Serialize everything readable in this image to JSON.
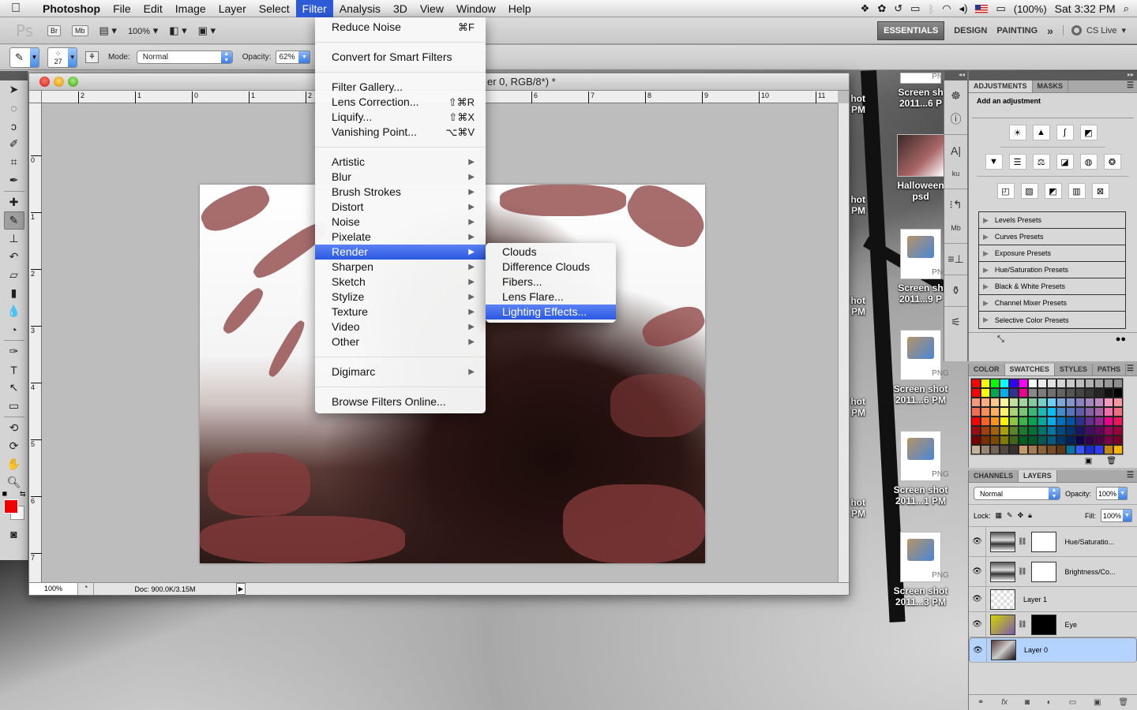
{
  "menubar": {
    "app_name": "Photoshop",
    "items": [
      "File",
      "Edit",
      "Image",
      "Layer",
      "Select",
      "Filter",
      "Analysis",
      "3D",
      "View",
      "Window",
      "Help"
    ],
    "active_item": "Filter",
    "battery": "(100%)",
    "clock": "Sat 3:32 PM"
  },
  "appbar": {
    "logo": "Ps",
    "bridge": "Br",
    "minibridge": "Mb",
    "zoom": "100%",
    "workspaces": [
      "ESSENTIALS",
      "DESIGN",
      "PAINTING"
    ],
    "active_workspace": "ESSENTIALS",
    "more": "»",
    "cs_live": "CS Live"
  },
  "options": {
    "brush_size": "27",
    "mode_label": "Mode:",
    "mode_value": "Normal",
    "opacity_label": "Opacity:",
    "opacity_value": "62%"
  },
  "document": {
    "title": "er 0, RGB/8*) *",
    "ruler_h": [
      "2",
      "1",
      "0",
      "1",
      "2",
      "6",
      "7",
      "8",
      "9",
      "10",
      "11"
    ],
    "ruler_v": [
      "0",
      "1",
      "2",
      "3",
      "4",
      "5",
      "6",
      "7"
    ],
    "zoom": "100%",
    "doc_size": "Doc: 900.0K/3.15M"
  },
  "filter_menu": {
    "items": [
      {
        "label": "Reduce Noise",
        "shortcut": "⌘F"
      },
      {
        "sep": true
      },
      {
        "label": "Convert for Smart Filters",
        "shortcut": ""
      },
      {
        "sep": true
      },
      {
        "label": "Filter Gallery...",
        "shortcut": ""
      },
      {
        "label": "Lens Correction...",
        "shortcut": "⇧⌘R"
      },
      {
        "label": "Liquify...",
        "shortcut": "⇧⌘X"
      },
      {
        "label": "Vanishing Point...",
        "shortcut": "⌥⌘V"
      },
      {
        "sep": true
      },
      {
        "label": "Artistic",
        "submenu": true
      },
      {
        "label": "Blur",
        "submenu": true
      },
      {
        "label": "Brush Strokes",
        "submenu": true
      },
      {
        "label": "Distort",
        "submenu": true
      },
      {
        "label": "Noise",
        "submenu": true
      },
      {
        "label": "Pixelate",
        "submenu": true
      },
      {
        "label": "Render",
        "submenu": true,
        "highlighted": true
      },
      {
        "label": "Sharpen",
        "submenu": true
      },
      {
        "label": "Sketch",
        "submenu": true
      },
      {
        "label": "Stylize",
        "submenu": true
      },
      {
        "label": "Texture",
        "submenu": true
      },
      {
        "label": "Video",
        "submenu": true
      },
      {
        "label": "Other",
        "submenu": true
      },
      {
        "sep": true
      },
      {
        "label": "Digimarc",
        "submenu": true
      },
      {
        "sep": true
      },
      {
        "label": "Browse Filters Online...",
        "shortcut": ""
      }
    ]
  },
  "render_submenu": {
    "items": [
      "Clouds",
      "Difference Clouds",
      "Fibers...",
      "Lens Flare...",
      "Lighting Effects..."
    ],
    "highlighted": "Lighting Effects..."
  },
  "adjustments_panel": {
    "tabs": [
      "ADJUSTMENTS",
      "MASKS"
    ],
    "active_tab": "ADJUSTMENTS",
    "title": "Add an adjustment",
    "presets": [
      "Levels Presets",
      "Curves Presets",
      "Exposure Presets",
      "Hue/Saturation Presets",
      "Black & White Presets",
      "Channel Mixer Presets",
      "Selective Color Presets"
    ]
  },
  "swatches_panel": {
    "tabs": [
      "COLOR",
      "SWATCHES",
      "STYLES",
      "PATHS"
    ],
    "active_tab": "SWATCHES",
    "colors": [
      "#ff0000",
      "#ffff00",
      "#00ff00",
      "#00ffff",
      "#3300ff",
      "#ff00ff",
      "#ffffff",
      "#ebebeb",
      "#e0e0e0",
      "#d4d4d4",
      "#c8c8c8",
      "#bcbcbc",
      "#b0b0b0",
      "#a4a4a4",
      "#999999",
      "#8e8e8e",
      "#ff0000",
      "#ffff00",
      "#00a651",
      "#00aeef",
      "#2e3192",
      "#ec008c",
      "#898989",
      "#7d7d7d",
      "#707070",
      "#646464",
      "#555555",
      "#464646",
      "#363636",
      "#262626",
      "#111111",
      "#000000",
      "#f7977a",
      "#f9ad81",
      "#fdc68a",
      "#fff79a",
      "#c4df9b",
      "#a3d39c",
      "#82ca9d",
      "#7bcdc8",
      "#6ecff6",
      "#7ea7d8",
      "#8493ca",
      "#8882be",
      "#a187be",
      "#bc8dbf",
      "#f49ac2",
      "#f6989d",
      "#f26c4f",
      "#f68e55",
      "#fbaf5c",
      "#fff467",
      "#acd372",
      "#7cc576",
      "#3bb878",
      "#1abbb4",
      "#00bff3",
      "#438ccb",
      "#5574b9",
      "#605ca8",
      "#855fa8",
      "#a763a8",
      "#f06ea9",
      "#f26d7d",
      "#ff0000",
      "#f26522",
      "#f7941d",
      "#fff200",
      "#8dc63f",
      "#39b54a",
      "#00a651",
      "#00a99d",
      "#00aeef",
      "#0072bc",
      "#0054a6",
      "#2e3192",
      "#662d91",
      "#92278f",
      "#ec008c",
      "#ed145b",
      "#9e0b0f",
      "#a0410d",
      "#a36209",
      "#aba000",
      "#598527",
      "#1a7b30",
      "#007236",
      "#00746b",
      "#0076a3",
      "#004b80",
      "#003471",
      "#1b1464",
      "#440e62",
      "#630460",
      "#9e005d",
      "#9e0039",
      "#790000",
      "#7b2e00",
      "#7d4900",
      "#827b00",
      "#406618",
      "#005e20",
      "#005826",
      "#005952",
      "#005b7f",
      "#003663",
      "#002157",
      "#0d004c",
      "#32004b",
      "#4b0049",
      "#7b0046",
      "#7a0026",
      "#c7b299",
      "#998675",
      "#736357",
      "#534741",
      "#37302d",
      "#c69c6d",
      "#a67c52",
      "#8c6239",
      "#754c24",
      "#603913",
      "#0076a3",
      "#3857fc",
      "#1c2bd1",
      "#2e3bff",
      "#c8860a",
      "#ffb400"
    ]
  },
  "layers_panel": {
    "tabs": [
      "CHANNELS",
      "LAYERS"
    ],
    "active_tab": "LAYERS",
    "blend_mode": "Normal",
    "opacity_label": "Opacity:",
    "opacity_value": "100%",
    "lock_label": "Lock:",
    "fill_label": "Fill:",
    "fill_value": "100%",
    "layers": [
      {
        "name": "Hue/Saturatio...",
        "type": "adjustment",
        "selected": false
      },
      {
        "name": "Brightness/Co...",
        "type": "adjustment",
        "selected": false
      },
      {
        "name": "Layer 1",
        "type": "pixel",
        "selected": false
      },
      {
        "name": "Eye",
        "type": "masked",
        "selected": false
      },
      {
        "name": "Layer 0",
        "type": "pixel",
        "selected": true
      }
    ]
  },
  "desktop_icons": [
    {
      "label1": "Screen sh",
      "label2": "2011...6 P",
      "kind": "png"
    },
    {
      "label1": "Halloween",
      "label2": "psd",
      "kind": "psd"
    },
    {
      "label1": "Screen sh",
      "label2": "2011...9 P",
      "kind": "png"
    },
    {
      "label1": "Screen shot",
      "label2": "2011...6 PM",
      "kind": "png"
    },
    {
      "label1": "Screen shot",
      "label2": "2011...1 PM",
      "kind": "png"
    },
    {
      "label1": "Screen shot",
      "label2": "2011...3 PM",
      "kind": "png"
    }
  ],
  "desktop_partial_labels": [
    {
      "l1": "hot",
      "l2": "PM"
    },
    {
      "l1": "hot",
      "l2": "PM"
    },
    {
      "l1": "hot",
      "l2": "PM"
    },
    {
      "l1": "hot",
      "l2": "PM"
    },
    {
      "l1": "hot",
      "l2": "PM"
    }
  ],
  "file_badge": "PNG",
  "colors": {
    "foreground": "#e00000",
    "background": "#ffffff",
    "menu_highlight": "#2d5bd8"
  }
}
